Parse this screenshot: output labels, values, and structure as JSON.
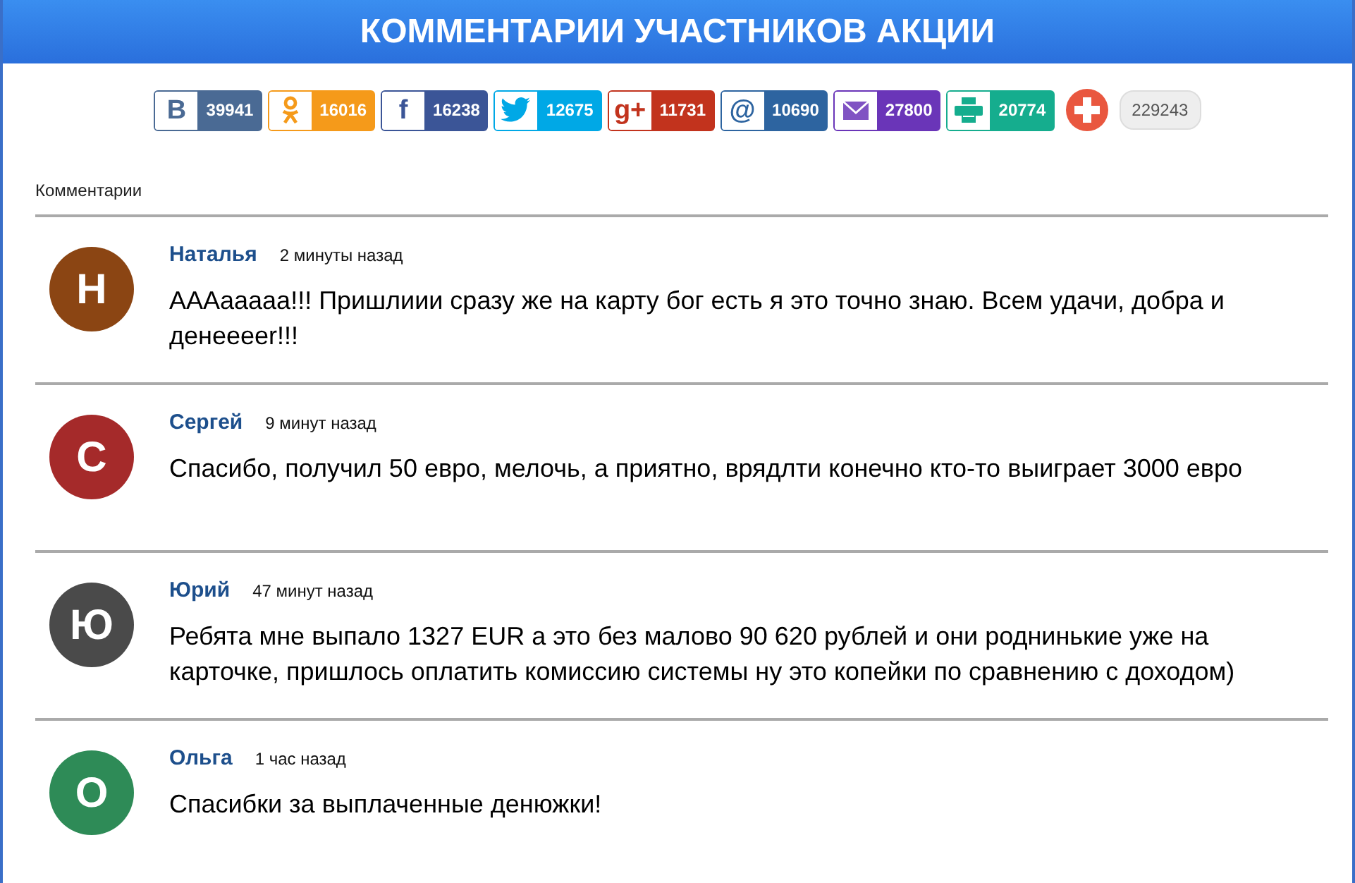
{
  "header": {
    "title": "КОММЕНТАРИИ УЧАСТНИКОВ АКЦИИ"
  },
  "share_buttons": [
    {
      "kind": "vk",
      "glyph": "В",
      "count": "39941",
      "color": "#4a6a94"
    },
    {
      "kind": "ok",
      "count": "16016",
      "color": "#f59a1a"
    },
    {
      "kind": "fb",
      "glyph": "f",
      "count": "16238",
      "color": "#3b5597"
    },
    {
      "kind": "twitter",
      "count": "12675",
      "color": "#00a8e6"
    },
    {
      "kind": "gplus",
      "glyph": "g+",
      "count": "11731",
      "color": "#c2331d"
    },
    {
      "kind": "mail",
      "glyph": "@",
      "count": "10690",
      "color": "#2d64a0"
    },
    {
      "kind": "email",
      "count": "27800",
      "color": "#6a35b8"
    },
    {
      "kind": "print",
      "count": "20774",
      "color": "#15ad8e"
    }
  ],
  "share_total": {
    "count": "229243"
  },
  "comments_label": "Комментарии",
  "comments": [
    {
      "avatar": "Н",
      "color": "#8b4513",
      "name": "Наталья",
      "time": "2 минуты назад",
      "text": "AAAaaaaa!!! Пришлиии сразу же на карту бог есть я это точно знаю. Всем удачи, добра и денееееr!!!"
    },
    {
      "avatar": "С",
      "color": "#a52a2a",
      "name": "Сергей",
      "time": "9 минут назад",
      "text": "Спасибо, получил 50 евро, мелочь, а приятно, врядлти конечно кто-то выиграет 3000 евро"
    },
    {
      "avatar": "Ю",
      "color": "#4a4a4a",
      "name": "Юрий",
      "time": "47 минут назад",
      "text": "Ребята мне выпало 1327 EUR а это без малово 90 620 рублей и они роднинькие уже на карточке, пришлось оплатить комиссию системы ну это копейки по сравнению с доходом)"
    },
    {
      "avatar": "О",
      "color": "#2e8b57",
      "name": "Ольга",
      "time": "1 час назад",
      "text": "Спасибки за выплаченные денюжки!"
    }
  ]
}
